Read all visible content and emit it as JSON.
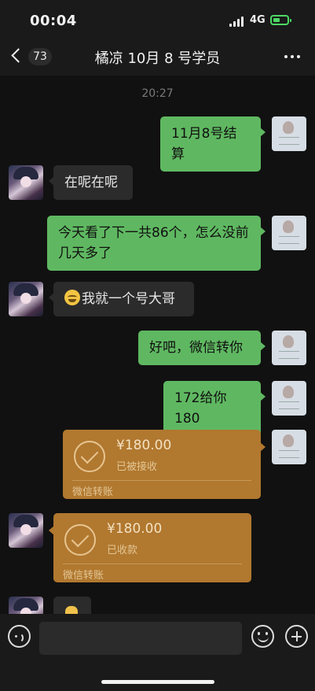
{
  "status_bar": {
    "time": "00:04",
    "network": "4G"
  },
  "nav": {
    "unread_count": "73",
    "title": "橘凉 10月 8 号学员"
  },
  "chat": {
    "time_divider": "20:27",
    "messages": [
      {
        "side": "out",
        "text": "11月8号结算"
      },
      {
        "side": "in",
        "text": "在呢在呢"
      },
      {
        "side": "out",
        "text": "今天看了下一共86个，怎么没前几天多了"
      },
      {
        "side": "in",
        "text": "我就一个号大哥",
        "emoji": "grinning-sweat-emoji"
      },
      {
        "side": "out",
        "text": "好吧，微信转你"
      },
      {
        "side": "out",
        "text": "172给你180"
      }
    ],
    "transfers": [
      {
        "side": "out",
        "amount": "¥180.00",
        "status": "已被接收",
        "label": "微信转账"
      },
      {
        "side": "in",
        "amount": "¥180.00",
        "status": "已收款",
        "label": "微信转账"
      }
    ]
  },
  "input_bar": {
    "placeholder": ""
  },
  "colors": {
    "outgoing": "#5fb861",
    "incoming": "#2b2b2b",
    "transfer": "#b1782f",
    "background": "#111111"
  }
}
